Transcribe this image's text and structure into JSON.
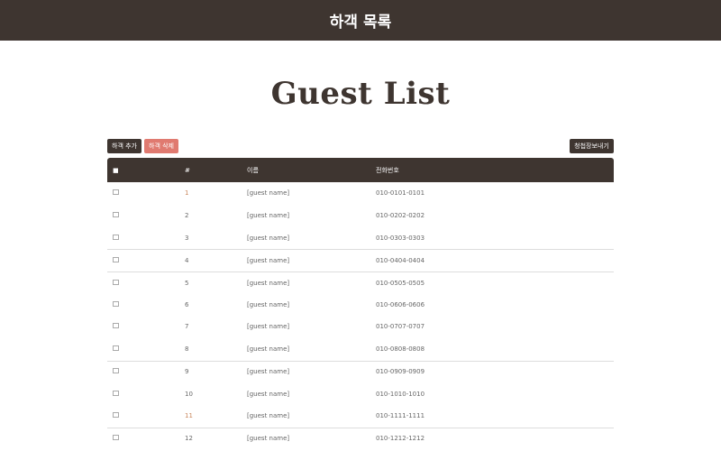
{
  "topbar": {
    "title": "하객 목록"
  },
  "heading": "Guest List",
  "buttons": {
    "add": "하객 추가",
    "delete": "하객 삭제",
    "send": "청첩장보내기"
  },
  "table": {
    "headers": {
      "check": "■",
      "num": "#",
      "name": "이름",
      "phone": "전화번호"
    },
    "rows": [
      {
        "num": "1",
        "name": "[guest name]",
        "phone": "010-0101-0101"
      },
      {
        "num": "2",
        "name": "[guest name]",
        "phone": "010-0202-0202"
      },
      {
        "num": "3",
        "name": "[guest name]",
        "phone": "010-0303-0303"
      },
      {
        "num": "4",
        "name": "[guest name]",
        "phone": "010-0404-0404"
      },
      {
        "num": "5",
        "name": "[guest name]",
        "phone": "010-0505-0505"
      },
      {
        "num": "6",
        "name": "[guest name]",
        "phone": "010-0606-0606"
      },
      {
        "num": "7",
        "name": "[guest name]",
        "phone": "010-0707-0707"
      },
      {
        "num": "8",
        "name": "[guest name]",
        "phone": "010-0808-0808"
      },
      {
        "num": "9",
        "name": "[guest name]",
        "phone": "010-0909-0909"
      },
      {
        "num": "10",
        "name": "[guest name]",
        "phone": "010-1010-1010"
      },
      {
        "num": "11",
        "name": "[guest name]",
        "phone": "010-1111-1111"
      },
      {
        "num": "12",
        "name": "[guest name]",
        "phone": "010-1212-1212"
      }
    ]
  }
}
